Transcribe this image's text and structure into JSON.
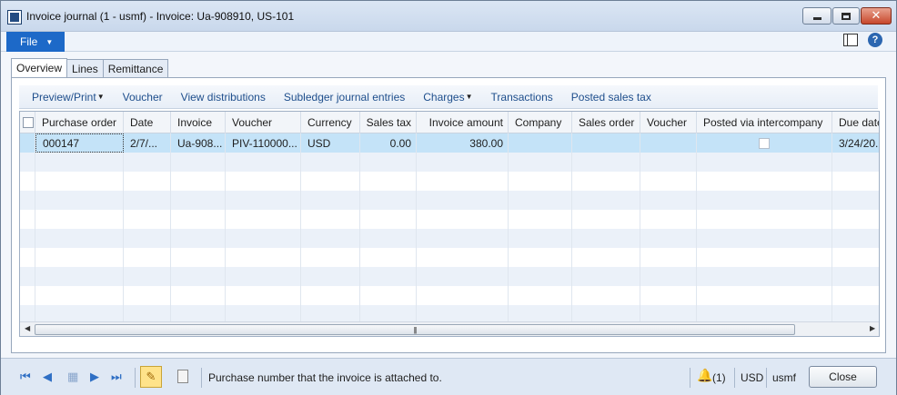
{
  "window": {
    "title": "Invoice journal (1 - usmf) - Invoice: Ua-908910, US-101"
  },
  "menu": {
    "file_label": "File",
    "help_label": "?"
  },
  "tabs": [
    {
      "label": "Overview",
      "active": true
    },
    {
      "label": "Lines",
      "active": false
    },
    {
      "label": "Remittance",
      "active": false
    }
  ],
  "actions": [
    {
      "label": "Preview/Print",
      "dropdown": true
    },
    {
      "label": "Voucher",
      "dropdown": false
    },
    {
      "label": "View distributions",
      "dropdown": false
    },
    {
      "label": "Subledger journal entries",
      "dropdown": false
    },
    {
      "label": "Charges",
      "dropdown": true
    },
    {
      "label": "Transactions",
      "dropdown": false
    },
    {
      "label": "Posted sales tax",
      "dropdown": false
    }
  ],
  "grid": {
    "columns": [
      "Purchase order",
      "Date",
      "Invoice",
      "Voucher",
      "Currency",
      "Sales tax",
      "Invoice amount",
      "Company",
      "Sales order",
      "Voucher",
      "Posted via intercompany",
      "Due date"
    ],
    "rows": [
      {
        "purchase_order": "000147",
        "date": "2/7/...",
        "invoice": "Ua-908...",
        "voucher": "PIV-110000...",
        "currency": "USD",
        "sales_tax": "0.00",
        "invoice_amount": "380.00",
        "company": "",
        "sales_order": "",
        "voucher2": "",
        "posted_via_intercompany": false,
        "due_date": "3/24/20..."
      }
    ]
  },
  "statusbar": {
    "help_text": "Purchase number that the invoice is attached to.",
    "notifications": "(1)",
    "currency": "USD",
    "company": "usmf",
    "close_label": "Close"
  },
  "colors": {
    "file_button": "#1d69c8",
    "selected_row": "#c4e3f8",
    "alt_row": "#ebf1f9",
    "action_link": "#1e4e8c"
  }
}
